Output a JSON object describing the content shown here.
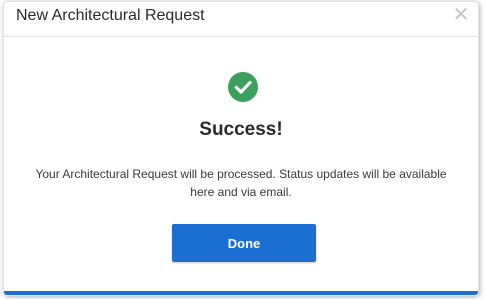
{
  "modal": {
    "title": "New Architectural Request",
    "close_glyph": "✕",
    "success_title": "Success!",
    "message": "Your Architectural Request will be processed. Status updates will be available here and via email.",
    "done_label": "Done"
  },
  "icons": {
    "close": "close-icon",
    "success": "check-circle-icon"
  },
  "colors": {
    "accent": "#1c6ed3",
    "success": "#3aa05c",
    "title_text": "#2b2b2b",
    "close_icon": "#c4c4c4"
  }
}
